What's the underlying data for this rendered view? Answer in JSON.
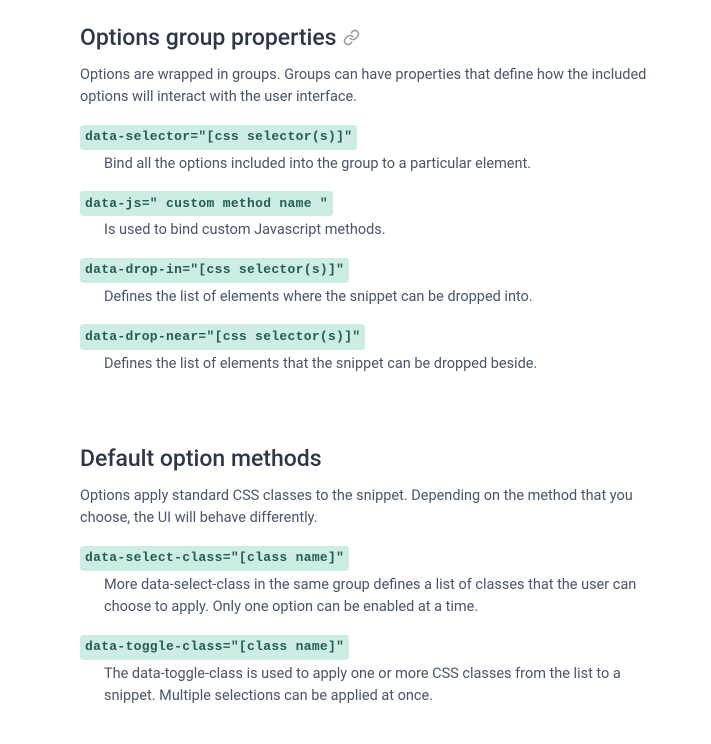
{
  "section1": {
    "heading": "Options group properties",
    "intro": "Options are wrapped in groups. Groups can have properties that define how the included options will interact with the user interface.",
    "items": [
      {
        "code": "data-selector=\"[css selector(s)]\"",
        "desc": "Bind all the options included into the group to a particular element."
      },
      {
        "code": "data-js=\" custom method name \"",
        "desc": "Is used to bind custom Javascript methods."
      },
      {
        "code": "data-drop-in=\"[css selector(s)]\"",
        "desc": "Defines the list of elements where the snippet can be dropped into."
      },
      {
        "code": "data-drop-near=\"[css selector(s)]\"",
        "desc": "Defines the list of elements that the snippet can be dropped beside."
      }
    ]
  },
  "section2": {
    "heading": "Default option methods",
    "intro": "Options apply standard CSS classes to the snippet. Depending on the method that you choose, the UI will behave differently.",
    "items": [
      {
        "code": "data-select-class=\"[class name]\"",
        "desc": "More data-select-class in the same group defines a list of classes that the user can choose to apply. Only one option can be enabled at a time."
      },
      {
        "code": "data-toggle-class=\"[class name]\"",
        "desc": "The data-toggle-class is used to apply one or more CSS classes from the list to a snippet. Multiple selections can be applied at once."
      }
    ]
  }
}
